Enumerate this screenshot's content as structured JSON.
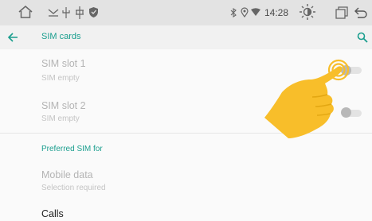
{
  "status_bar": {
    "time": "14:28",
    "icons": [
      "home-icon",
      "usb-icon",
      "usb-icon",
      "usb-icon",
      "shield-icon",
      "bluetooth-icon",
      "location-icon",
      "wifi-icon",
      "brightness-icon",
      "window-icon",
      "back-arrow-icon"
    ]
  },
  "app_bar": {
    "title": "SIM cards",
    "back_icon": "back-arrow-icon",
    "search_icon": "search-icon"
  },
  "sim_slots": [
    {
      "title": "SIM slot 1",
      "subtitle": "SIM empty",
      "toggle_on": false
    },
    {
      "title": "SIM slot 2",
      "subtitle": "SIM empty",
      "toggle_on": false
    }
  ],
  "preferred_section": {
    "header": "Preferred SIM for",
    "items": [
      {
        "title": "Mobile data",
        "subtitle": "Selection required"
      },
      {
        "title": "Calls"
      }
    ]
  },
  "colors": {
    "accent": "#1a9e8e",
    "status_bar_bg": "#e3e3e3",
    "app_bar_bg": "#f1f1f1",
    "hand": "#f8be2a"
  }
}
